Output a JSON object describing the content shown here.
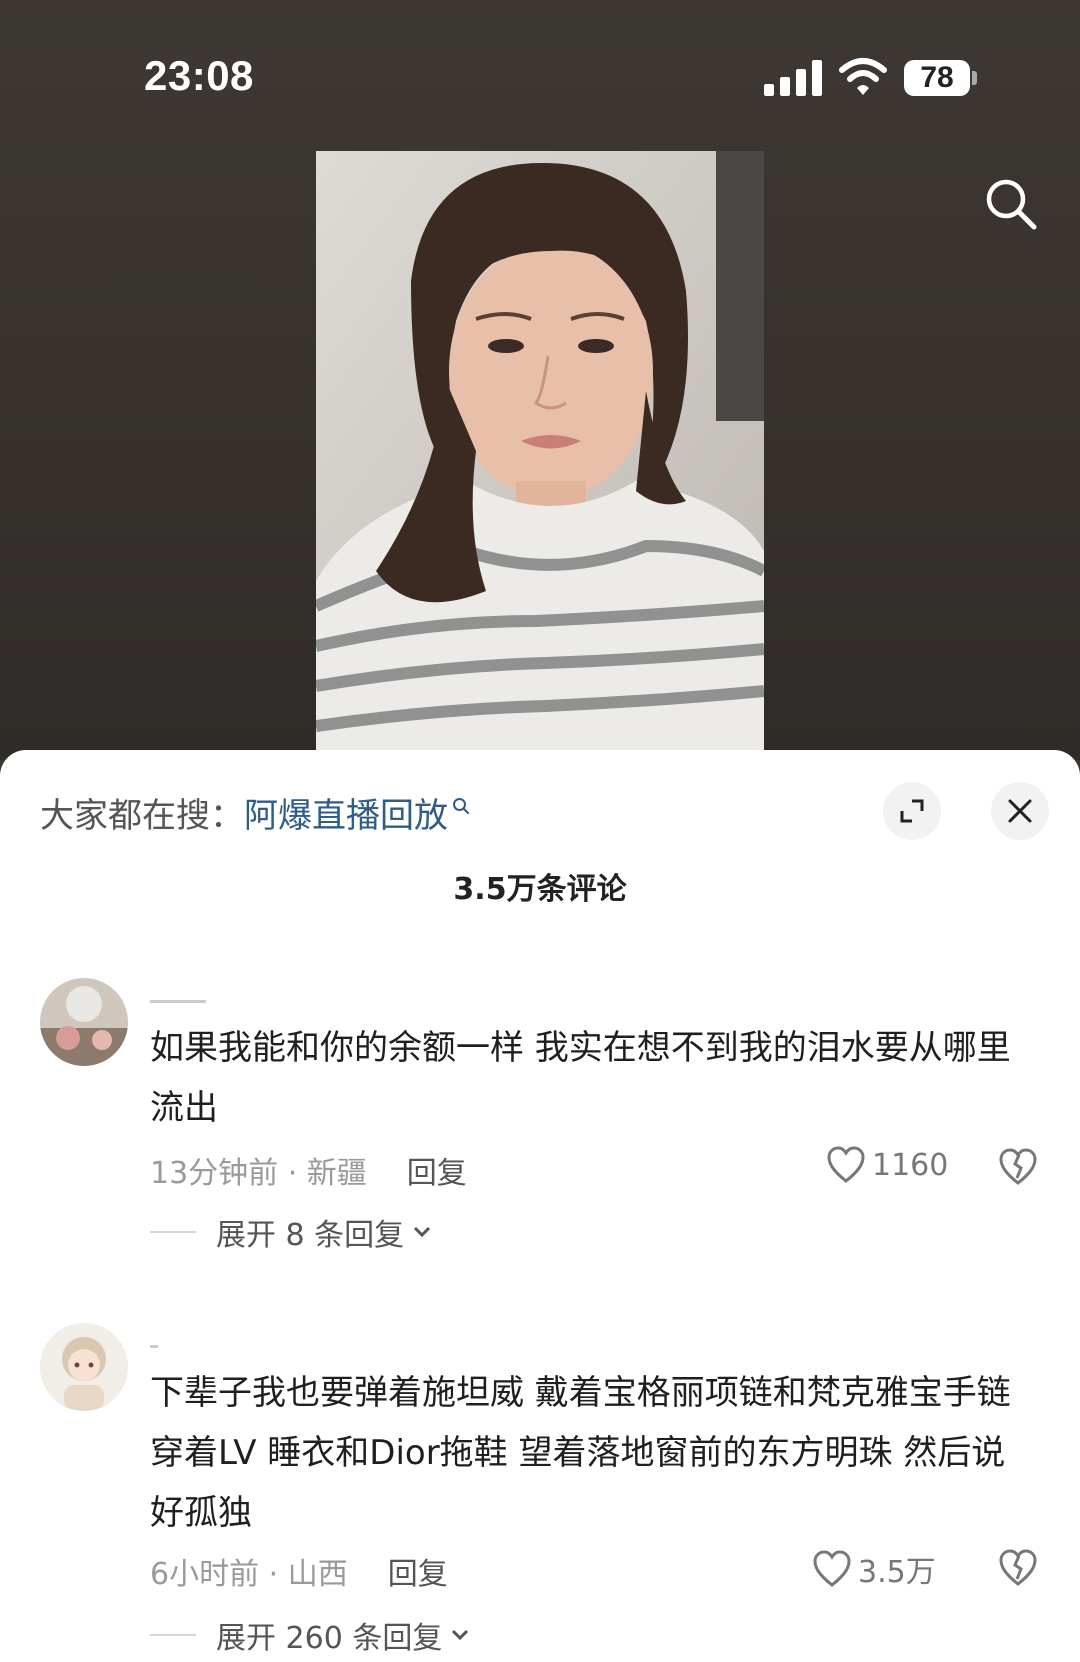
{
  "status_bar": {
    "time": "23:08",
    "battery": "78"
  },
  "search_prompt": {
    "prefix": "大家都在搜：",
    "term": "阿爆直播回放"
  },
  "comments_header": {
    "count_label": "3.5万条评论"
  },
  "comments": [
    {
      "text": "如果我能和你的余额一样 我实在想不到我的泪水要从哪里流出",
      "time_location": "13分钟前 · 新疆",
      "reply_label": "回复",
      "likes": "1160",
      "expand_label": "展开 8 条回复"
    },
    {
      "text": "下辈子我也要弹着施坦威 戴着宝格丽项链和梵克雅宝手链 穿着LV 睡衣和Dior拖鞋 望着落地窗前的东方明珠 然后说好孤独",
      "time_location": "6小时前 · 山西",
      "reply_label": "回复",
      "likes": "3.5万",
      "expand_label": "展开 260 条回复"
    }
  ],
  "colors": {
    "sheet_bg": "#ffffff",
    "video_bg": "#3b3632",
    "search_term": "#2f5d86",
    "meta_gray": "#9a9a9a"
  },
  "icons": [
    "signal-icon",
    "wifi-icon",
    "battery-icon",
    "search-icon",
    "expand-icon",
    "close-icon",
    "heart-icon",
    "broken-heart-icon",
    "chevron-down-icon"
  ]
}
